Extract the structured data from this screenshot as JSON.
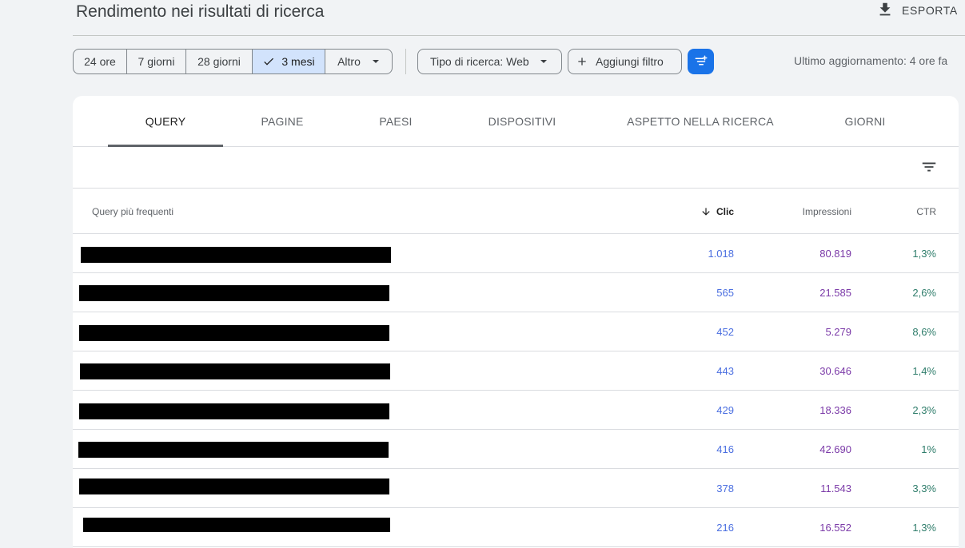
{
  "header": {
    "title": "Rendimento nei risultati di ricerca",
    "export_label": "ESPORTA"
  },
  "filters": {
    "date_ranges": [
      {
        "label": "24 ore",
        "selected": false
      },
      {
        "label": "7 giorni",
        "selected": false
      },
      {
        "label": "28 giorni",
        "selected": false
      },
      {
        "label": "3 mesi",
        "selected": true
      },
      {
        "label": "Altro",
        "selected": false
      }
    ],
    "search_type": "Tipo di ricerca: Web",
    "add_filter": "Aggiungi filtro",
    "last_update": "Ultimo aggiornamento: 4 ore fa"
  },
  "tabs": [
    {
      "label": "QUERY",
      "active": true
    },
    {
      "label": "PAGINE",
      "active": false
    },
    {
      "label": "PAESI",
      "active": false
    },
    {
      "label": "DISPOSITIVI",
      "active": false
    },
    {
      "label": "ASPETTO NELLA RICERCA",
      "active": false
    },
    {
      "label": "GIORNI",
      "active": false
    }
  ],
  "table": {
    "columns": {
      "query": "Query più frequenti",
      "clic": "Clic",
      "impressioni": "Impressioni",
      "ctr": "CTR"
    },
    "sorted_column": "clic",
    "rows": [
      {
        "clic": "1.018",
        "impressioni": "80.819",
        "ctr": "1,3%"
      },
      {
        "clic": "565",
        "impressioni": "21.585",
        "ctr": "2,6%"
      },
      {
        "clic": "452",
        "impressioni": "5.279",
        "ctr": "8,6%"
      },
      {
        "clic": "443",
        "impressioni": "30.646",
        "ctr": "1,4%"
      },
      {
        "clic": "429",
        "impressioni": "18.336",
        "ctr": "2,3%"
      },
      {
        "clic": "416",
        "impressioni": "42.690",
        "ctr": "1%"
      },
      {
        "clic": "378",
        "impressioni": "11.543",
        "ctr": "3,3%"
      },
      {
        "clic": "216",
        "impressioni": "16.552",
        "ctr": "1,3%"
      }
    ]
  },
  "colors": {
    "selected_chip": "#d2e3fc",
    "accent_blue": "#1a73e8",
    "clic_color": "#4a6ee0",
    "impressions_color": "#7b3aa8",
    "ctr_color": "#2f7d6b"
  },
  "icons": {
    "export": "download-icon",
    "check": "check-icon",
    "caret": "caret-down-icon",
    "add": "plus-icon",
    "filter_settings": "filter-settings-icon",
    "table_filter": "filter-lines-icon",
    "sort": "arrow-down-icon"
  }
}
